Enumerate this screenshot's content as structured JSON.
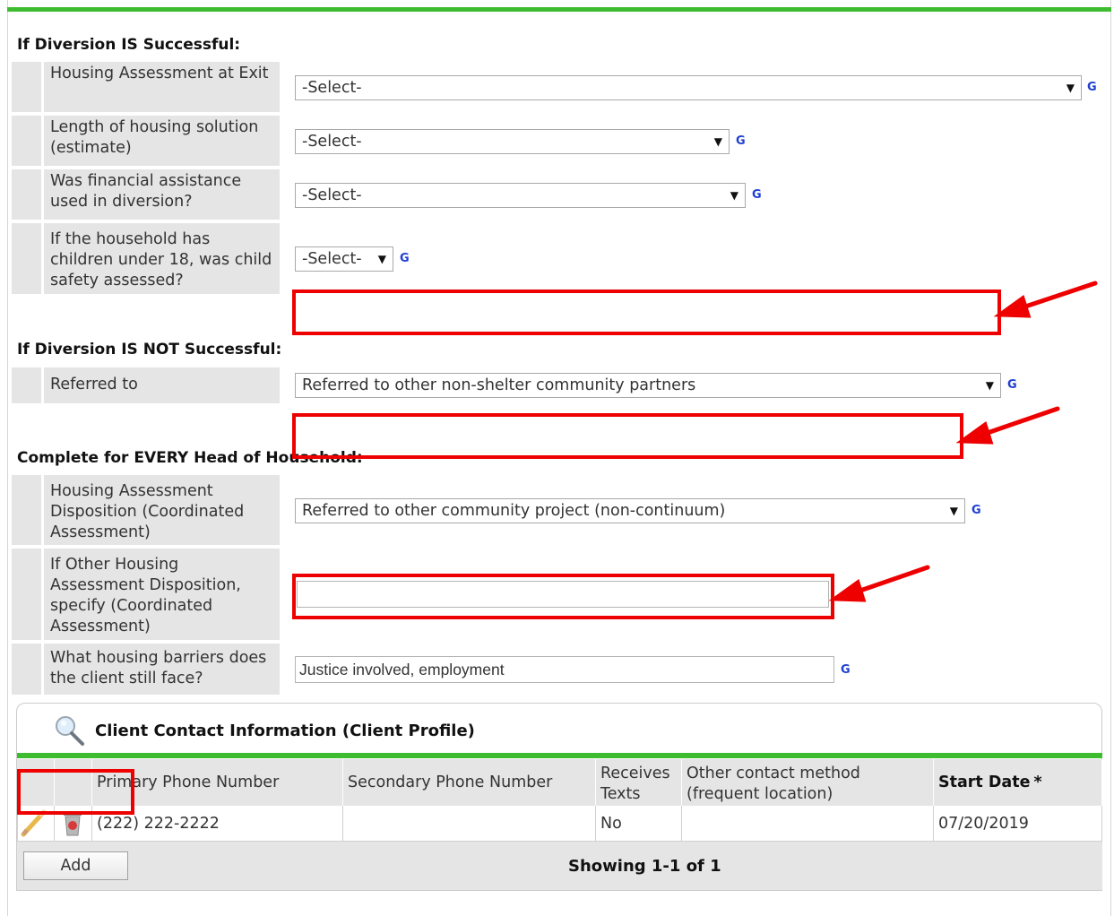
{
  "successful": {
    "title": "If Diversion IS Successful:",
    "rows": [
      {
        "label": "Housing Assessment at Exit",
        "value": "-Select-",
        "help": "G"
      },
      {
        "label": "Length of housing solution (estimate)",
        "value": "-Select-",
        "help": "G"
      },
      {
        "label": "Was financial assistance used in diversion?",
        "value": "-Select-",
        "help": "G"
      },
      {
        "label": "If the household has children under 18, was child safety assessed?",
        "value": "-Select-",
        "help": "G"
      }
    ]
  },
  "not_successful": {
    "title": "If Diversion IS NOT Successful:",
    "rows": [
      {
        "label": "Referred to",
        "value": "Referred to other non-shelter community partners",
        "help": "G"
      }
    ]
  },
  "head_of_household": {
    "title": "Complete for EVERY Head of Household:",
    "rows": [
      {
        "label": "Housing Assessment Disposition (Coordinated Assessment)",
        "value": "Referred to other community project (non-continuum)",
        "help": "G"
      },
      {
        "label": "If Other Housing Assessment Disposition, specify (Coordinated Assessment)",
        "value": ""
      },
      {
        "label": "What housing barriers does the client still face?",
        "value": "Justice involved, employment",
        "help": "G"
      }
    ]
  },
  "contact": {
    "title": "Client Contact Information (Client Profile)",
    "headers": [
      "Primary Phone Number",
      "Secondary Phone Number",
      "Receives Texts",
      "Other contact method (frequent location)",
      "Start Date"
    ],
    "required_mark": "*",
    "rows": [
      {
        "primary": "(222) 222-2222",
        "secondary": "",
        "texts": "No",
        "other": "",
        "start": "07/20/2019"
      }
    ],
    "add_label": "Add",
    "showing": "Showing 1-1 of 1"
  },
  "colors": {
    "accent_green": "#3cbc2e",
    "annotation_red": "#ee0000",
    "help_blue": "#1f3fd1"
  }
}
